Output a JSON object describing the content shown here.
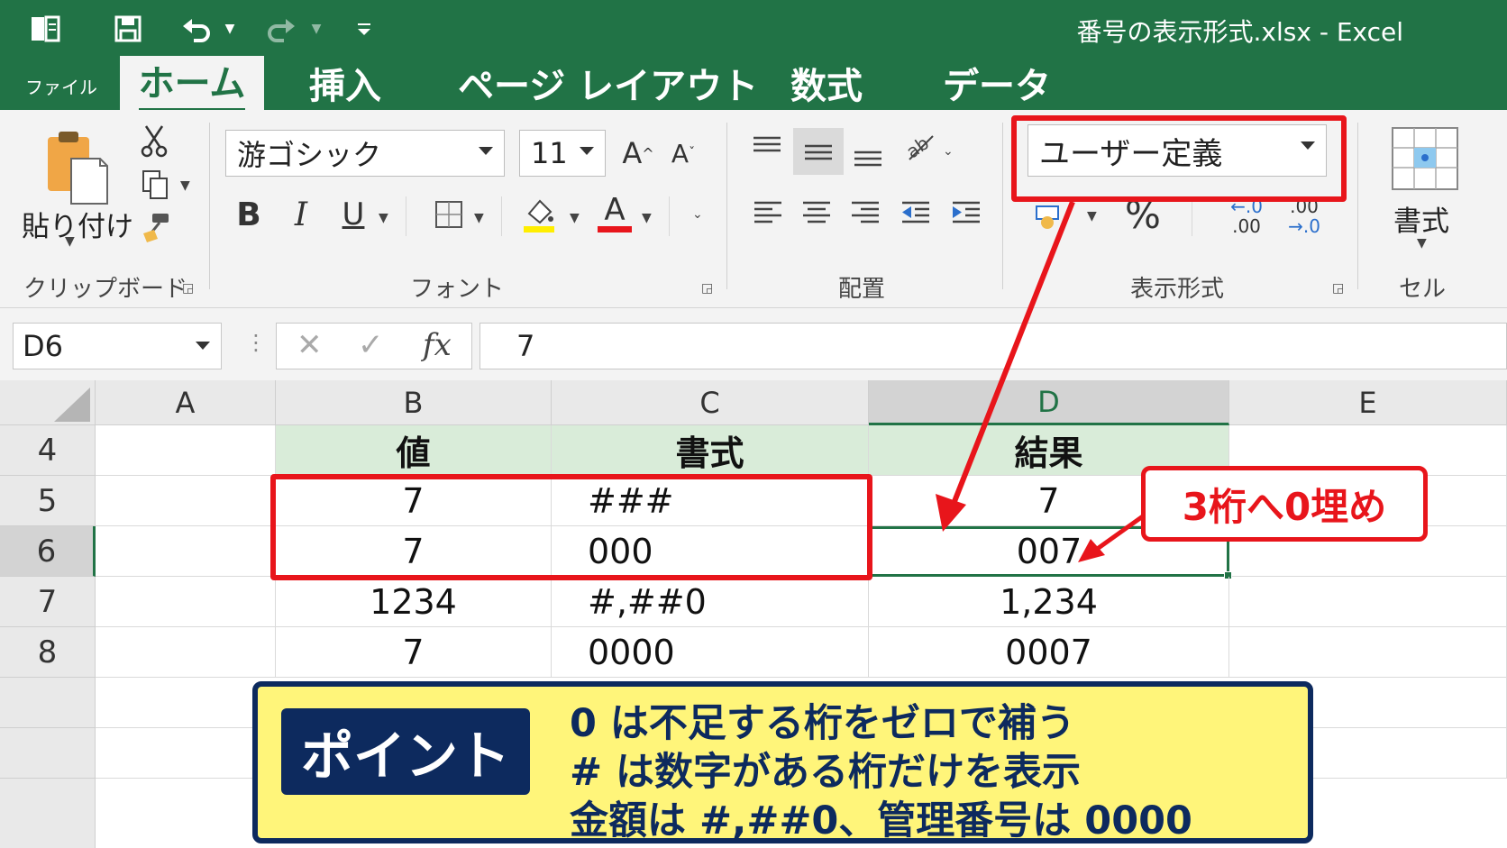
{
  "window": {
    "title": "番号の表示形式.xlsx  -  Excel"
  },
  "tabs": {
    "file": "ファイル",
    "home": "ホーム",
    "insert": "挿入",
    "page_layout": "ページ レイアウト",
    "formulas": "数式",
    "data": "データ"
  },
  "ribbon": {
    "clipboard": {
      "paste_label": "貼り付け",
      "group_label": "クリップボード"
    },
    "font": {
      "font_name": "游ゴシック",
      "font_size": "11",
      "grow": "A",
      "shrink": "A",
      "bold": "B",
      "italic": "I",
      "underline": "U",
      "font_color_glyph": "A",
      "group_label": "フォント"
    },
    "alignment": {
      "group_label": "配置"
    },
    "number": {
      "format_value": "ユーザー定義",
      "percent": "%",
      "inc_top": "←.0",
      "inc_bottom": ".00",
      "dec_top": ".00",
      "dec_bottom": "→.0",
      "group_label": "表示形式"
    },
    "cells": {
      "format_label": "書式",
      "group_label": "セル"
    }
  },
  "formula_bar": {
    "name_box": "D6",
    "cancel": "✕",
    "enter": "✓",
    "fx": "fx",
    "value": "7"
  },
  "sheet": {
    "columns": [
      "A",
      "B",
      "C",
      "D",
      "E"
    ],
    "row_numbers": [
      "4",
      "5",
      "6",
      "7",
      "8"
    ],
    "headers": {
      "value": "値",
      "format": "書式",
      "result": "結果"
    },
    "rows": [
      {
        "value": "7",
        "format": "###",
        "result": "7"
      },
      {
        "value": "7",
        "format": "000",
        "result": "007"
      },
      {
        "value": "1234",
        "format": "#,##0",
        "result": "1,234"
      },
      {
        "value": "7",
        "format": "0000",
        "result": "0007"
      }
    ]
  },
  "annotation": {
    "callout": "3桁へ0埋め",
    "point_badge": "ポイント",
    "lines": [
      "0  は不足する桁をゼロで補う",
      "#  は数字がある桁だけを表示",
      "金額は #,##0、管理番号は 0000"
    ]
  },
  "colors": {
    "excel_green": "#217346",
    "highlight_red": "#e8151b",
    "panel_yellow": "#fff57a",
    "panel_navy": "#0d2a5e",
    "header_fill": "#d9ecd9"
  }
}
